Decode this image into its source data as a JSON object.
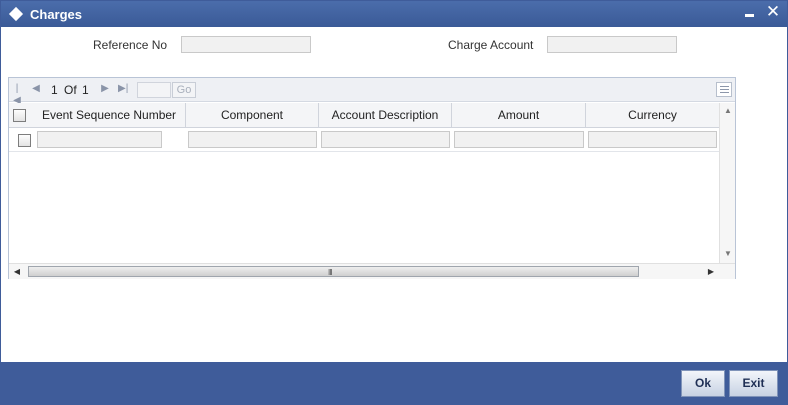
{
  "window": {
    "title": "Charges"
  },
  "form": {
    "reference_no_label": "Reference No",
    "reference_no_value": "",
    "charge_account_label": "Charge Account",
    "charge_account_value": ""
  },
  "pager": {
    "current": "1",
    "of_label": "Of",
    "total": "1",
    "page_input_value": "",
    "go_label": "Go"
  },
  "table": {
    "columns": [
      "Event Sequence Number",
      "Component",
      "Account Description",
      "Amount",
      "Currency"
    ],
    "rows": [
      {
        "event_sequence_number": "",
        "component": "",
        "account_description": "",
        "amount": "",
        "currency": ""
      }
    ]
  },
  "scrollbar": {
    "grip_label": "III"
  },
  "footer": {
    "ok_label": "Ok",
    "exit_label": "Exit"
  },
  "colors": {
    "titlebar": "#3f5c9a",
    "footer": "#3f5c9a",
    "input_bg": "#f1f1f1",
    "grid_border": "#b9c4d6"
  },
  "icons": {
    "window": "diamond-icon",
    "minimize": "minimize-icon",
    "close": "close-icon",
    "first": "first-page-icon",
    "prev": "prev-page-icon",
    "next": "next-page-icon",
    "last": "last-page-icon",
    "list": "list-view-icon"
  }
}
